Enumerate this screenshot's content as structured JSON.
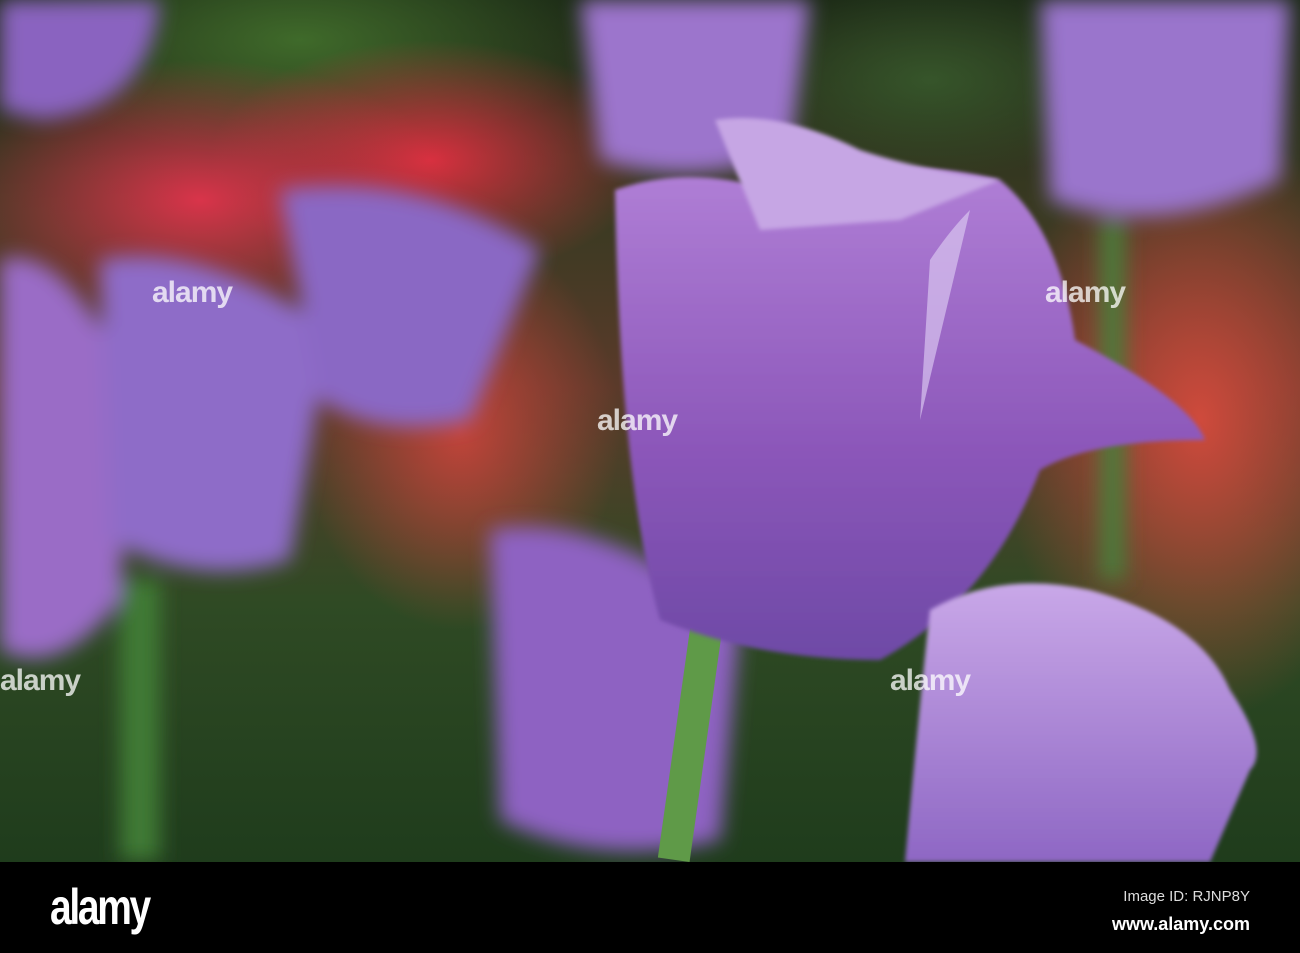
{
  "photo": {
    "subject": "Purple fringed tulips",
    "watermark": "alamy"
  },
  "footer": {
    "logo": "alamy",
    "image_id": "Image ID: RJNP8Y",
    "website": "www.alamy.com"
  }
}
